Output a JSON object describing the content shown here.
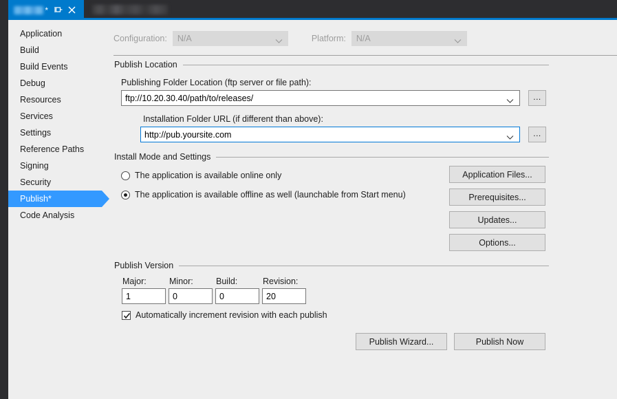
{
  "titlebar": {
    "tab_asterisk": "*",
    "pin_icon": "pin-icon",
    "close_icon": "close-icon"
  },
  "sidebar": {
    "items": [
      {
        "label": "Application",
        "selected": false
      },
      {
        "label": "Build",
        "selected": false
      },
      {
        "label": "Build Events",
        "selected": false
      },
      {
        "label": "Debug",
        "selected": false
      },
      {
        "label": "Resources",
        "selected": false
      },
      {
        "label": "Services",
        "selected": false
      },
      {
        "label": "Settings",
        "selected": false
      },
      {
        "label": "Reference Paths",
        "selected": false
      },
      {
        "label": "Signing",
        "selected": false
      },
      {
        "label": "Security",
        "selected": false
      },
      {
        "label": "Publish*",
        "selected": true
      },
      {
        "label": "Code Analysis",
        "selected": false
      }
    ]
  },
  "config_row": {
    "configuration_label": "Configuration:",
    "configuration_value": "N/A",
    "platform_label": "Platform:",
    "platform_value": "N/A"
  },
  "publish_location": {
    "group_title": "Publish Location",
    "folder_label": "Publishing Folder Location (ftp server or file path):",
    "folder_value": "ftp://10.20.30.40/path/to/releases/",
    "folder_browse": "...",
    "install_url_label": "Installation Folder URL (if different than above):",
    "install_url_value": "http://pub.yoursite.com",
    "install_url_browse": "..."
  },
  "install_mode": {
    "group_title": "Install Mode and Settings",
    "option_online": "The application is available online only",
    "option_offline": "The application is available offline as well (launchable from Start menu)",
    "selected_option": "offline",
    "buttons": [
      "Application Files...",
      "Prerequisites...",
      "Updates...",
      "Options..."
    ]
  },
  "publish_version": {
    "group_title": "Publish Version",
    "major_label": "Major:",
    "major_value": "1",
    "minor_label": "Minor:",
    "minor_value": "0",
    "build_label": "Build:",
    "build_value": "0",
    "revision_label": "Revision:",
    "revision_value": "20",
    "auto_increment_label": "Automatically increment revision with each publish",
    "auto_increment_checked": true
  },
  "actions": {
    "publish_wizard": "Publish Wizard...",
    "publish_now": "Publish Now"
  },
  "colors": {
    "accent_blue": "#007acc",
    "selection_blue": "#3399ff",
    "focus_border": "#0078d7",
    "dark_chrome": "#2d2d30",
    "panel_bg": "#eeeeee",
    "button_face": "#e1e1e1"
  }
}
